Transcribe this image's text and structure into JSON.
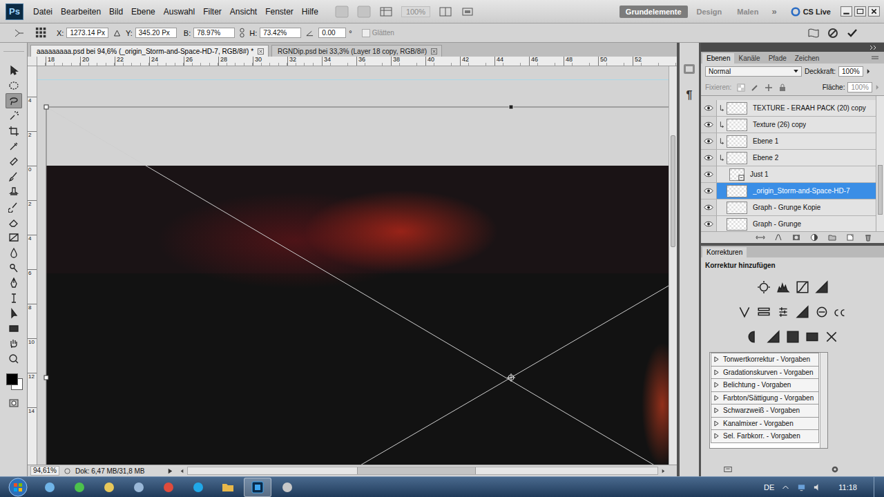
{
  "app": {
    "logo": "Ps"
  },
  "menu": [
    "Datei",
    "Bearbeiten",
    "Bild",
    "Ebene",
    "Auswahl",
    "Filter",
    "Ansicht",
    "Fenster",
    "Hilfe"
  ],
  "zoom_menu": {
    "value": "100%",
    "disabled": true
  },
  "workspaces": [
    {
      "label": "Grundelemente",
      "selected": true
    },
    {
      "label": "Design",
      "selected": false
    },
    {
      "label": "Malen",
      "selected": false
    }
  ],
  "workspace_more": "»",
  "cs_live": "CS Live",
  "options": {
    "x_label": "X:",
    "x": "1273.14 Px",
    "y_label": "Y:",
    "y": "345.20 Px",
    "w_label": "B:",
    "w": "78.97%",
    "h_label": "H:",
    "h": "73.42%",
    "angle": "0.00",
    "degree": "°",
    "antialias": {
      "label": "Glätten",
      "checked": false,
      "disabled": true
    }
  },
  "tools": [
    {
      "selected": false
    },
    {
      "selected": false
    },
    {
      "selected": true
    },
    {
      "selected": false
    },
    {
      "selected": false
    },
    {
      "selected": false
    },
    {
      "selected": false
    },
    {
      "selected": false
    },
    {
      "selected": false
    },
    {
      "selected": false
    },
    {
      "selected": false
    },
    {
      "selected": false
    },
    {
      "selected": false
    },
    {
      "selected": false
    },
    {
      "selected": false
    },
    {
      "selected": false
    },
    {
      "selected": false
    },
    {
      "selected": false
    },
    {
      "selected": false
    },
    {
      "selected": false
    }
  ],
  "colors": {
    "foreground": "#000000",
    "background": "#ffffff"
  },
  "documents": [
    {
      "title": "aaaaaaaaa.psd bei 94,6% (_origin_Storm-and-Space-HD-7, RGB/8#) *",
      "selected": true
    },
    {
      "title": "RGNDip.psd bei 33,3% (Layer 18 copy, RGB/8#)",
      "selected": false
    }
  ],
  "ruler_top": [
    "18",
    "20",
    "22",
    "24",
    "26",
    "28",
    "30",
    "32",
    "34",
    "36",
    "38",
    "40",
    "42",
    "44",
    "46",
    "48",
    "50",
    "52"
  ],
  "ruler_left": [
    "4",
    "2",
    "0",
    "2",
    "4",
    "6",
    "8",
    "10",
    "12",
    "14"
  ],
  "status": {
    "zoom": "94,61%",
    "doc": "Dok: 6,47 MB/31,8 MB"
  },
  "dock": {
    "paragraph": "¶"
  },
  "layers_panel": {
    "tabs": [
      {
        "label": "Ebenen",
        "selected": true
      },
      {
        "label": "Kanäle",
        "selected": false
      },
      {
        "label": "Pfade",
        "selected": false
      },
      {
        "label": "Zeichen",
        "selected": false
      }
    ],
    "blend_mode": "Normal",
    "opacity_label": "Deckkraft:",
    "opacity": "100%",
    "lock_label": "Fixieren:",
    "lock_disabled": true,
    "fill_label": "Fläche:",
    "fill": "100%",
    "fill_disabled": true
  },
  "layers": [
    {
      "name": "TEXTURE - ERAAH PACK (20) copy",
      "visible": true,
      "clipped": true,
      "selected": false,
      "kind": "pixel"
    },
    {
      "name": "Texture (26) copy",
      "visible": true,
      "clipped": true,
      "selected": false,
      "kind": "pixel"
    },
    {
      "name": "Ebene 1",
      "visible": true,
      "clipped": true,
      "selected": false,
      "kind": "pixel"
    },
    {
      "name": "Ebene 2",
      "visible": true,
      "clipped": true,
      "selected": false,
      "kind": "pixel"
    },
    {
      "name": "Just 1",
      "visible": true,
      "clipped": false,
      "selected": false,
      "kind": "smart"
    },
    {
      "name": "_origin_Storm-and-Space-HD-7",
      "visible": true,
      "clipped": false,
      "selected": true,
      "kind": "pixel"
    },
    {
      "name": "Graph - Grunge Kopie",
      "visible": true,
      "clipped": false,
      "selected": false,
      "kind": "pixel"
    },
    {
      "name": "Graph - Grunge",
      "visible": true,
      "clipped": false,
      "selected": false,
      "kind": "pixel"
    }
  ],
  "adjustments": {
    "tab": "Korrekturen",
    "title": "Korrektur hinzufügen",
    "presets": [
      {
        "label": "Tonwertkorrektur - Vorgaben",
        "expanded": false
      },
      {
        "label": "Gradationskurven - Vorgaben",
        "expanded": false
      },
      {
        "label": "Belichtung - Vorgaben",
        "expanded": false
      },
      {
        "label": "Farbton/Sättigung - Vorgaben",
        "expanded": false
      },
      {
        "label": "Schwarzweiß - Vorgaben",
        "expanded": false
      },
      {
        "label": "Kanalmixer - Vorgaben",
        "expanded": false
      },
      {
        "label": "Sel. Farbkorr. - Vorgaben",
        "expanded": false
      }
    ]
  },
  "taskbar": {
    "apps": [
      {
        "selected": false
      },
      {
        "selected": false
      },
      {
        "selected": false
      },
      {
        "selected": false
      },
      {
        "selected": false
      },
      {
        "selected": false
      },
      {
        "selected": false
      },
      {
        "selected": true
      },
      {
        "selected": false
      }
    ],
    "language": "DE",
    "time": "11:18"
  }
}
